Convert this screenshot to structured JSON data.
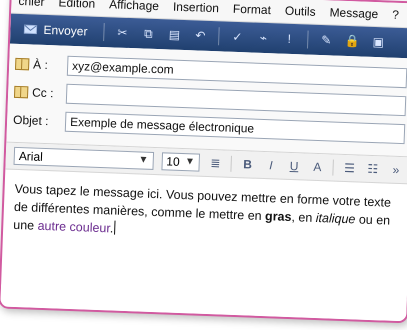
{
  "menu": [
    "chier",
    "Edition",
    "Affichage",
    "Insertion",
    "Format",
    "Outils",
    "Message",
    "?"
  ],
  "toolbar": {
    "send_label": "Envoyer"
  },
  "fields": {
    "to_label": "À :",
    "to_value": "xyz@example.com",
    "cc_label": "Cc :",
    "cc_value": "",
    "subject_label": "Objet :",
    "subject_value": "Exemple de message électronique"
  },
  "format": {
    "font": "Arial",
    "size": "10",
    "bold": "B",
    "italic": "I",
    "underline": "U",
    "color": "A"
  },
  "body": {
    "part1": "Vous tapez le message ici. Vous pouvez mettre en forme votre texte de différentes manières, comme le mettre en ",
    "bold_word": "gras",
    "part2": ", en ",
    "italic_word": "italique",
    "part3": " ou en une ",
    "colored_text": "autre couleur",
    "part4": "."
  },
  "colors": {
    "accent": "#d15aa0",
    "toolbar_top": "#3c5c96",
    "toolbar_bottom": "#20406f",
    "colored_text": "#6b2c8f"
  },
  "icons": {
    "send": "send-icon",
    "cut": "scissors-icon",
    "copy": "copy-icon",
    "paste": "paste-icon",
    "undo": "undo-icon",
    "spell": "spellcheck-icon",
    "attach": "paperclip-icon",
    "priority": "priority-icon",
    "sign": "signature-icon",
    "encrypt": "encrypt-icon",
    "offline": "offline-icon"
  }
}
